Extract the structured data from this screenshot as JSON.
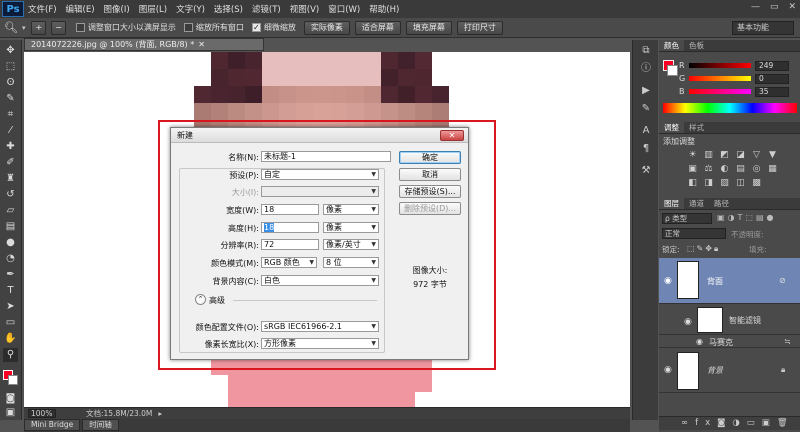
{
  "menubar": {
    "logo": "Ps",
    "items": [
      "文件(F)",
      "编辑(E)",
      "图像(I)",
      "图层(L)",
      "文字(Y)",
      "选择(S)",
      "滤镜(T)",
      "视图(V)",
      "窗口(W)",
      "帮助(H)"
    ],
    "window_controls": [
      "—",
      "▭",
      "✕"
    ]
  },
  "options": {
    "zoom_in_icon": "+",
    "zoom_out_icon": "−",
    "resize_windows_label": "调整窗口大小以满屏显示",
    "zoom_all_label": "缩放所有窗口",
    "scrubby_label": "细微缩放",
    "actual_pixels": "实际像素",
    "fit_screen": "适合屏幕",
    "fill_screen": "填充屏幕",
    "print_size": "打印尺寸",
    "workspace": "基本功能"
  },
  "document": {
    "tab_title": "20140722​26.jpg @ 100% (背面, RGB/8) *",
    "zoom": "100%",
    "doc_size": "文档:15.8M/23.0M",
    "bottom_tabs": [
      "Mini Bridge",
      "时间轴"
    ]
  },
  "panels": {
    "color_tabs": [
      "颜色",
      "色板"
    ],
    "color_values": [
      "249",
      "0",
      "35"
    ],
    "slider_labels": [
      "R",
      "G",
      "B"
    ],
    "adjust_tabs": [
      "调整",
      "样式"
    ],
    "adjust_title": "添加调整",
    "layer_tabs": [
      "图层",
      "通道",
      "路径"
    ],
    "kind_filter": "ρ 类型",
    "blend_mode": "正常",
    "opacity_label": "不透明度:",
    "lock_label": "锁定:",
    "fill_label": "填充:",
    "layers": [
      {
        "name": "背面"
      },
      {
        "name": "智能滤镜"
      },
      {
        "name": "马赛克"
      },
      {
        "name": "背景"
      }
    ]
  },
  "dialog": {
    "title": "新建",
    "name_label": "名称(N):",
    "name_value": "未标题-1",
    "preset_label": "预设(P):",
    "preset_value": "自定",
    "size_label": "大小(I):",
    "width_label": "宽度(W):",
    "width_value": "18",
    "width_unit": "像素",
    "height_label": "高度(H):",
    "height_value": "18",
    "height_unit": "像素",
    "res_label": "分辨率(R):",
    "res_value": "72",
    "res_unit": "像素/英寸",
    "mode_label": "颜色模式(M):",
    "mode_value": "RGB 颜色",
    "bit_value": "8 位",
    "bg_label": "背景内容(C):",
    "bg_value": "白色",
    "advanced_label": "高级",
    "profile_label": "颜色配置文件(O):",
    "profile_value": "sRGB IEC61966-2.1",
    "aspect_label": "像素长宽比(X):",
    "aspect_value": "方形像素",
    "ok": "确定",
    "cancel": "取消",
    "save_preset": "存储预设(S)...",
    "delete_preset": "删除预设(D)...",
    "image_size_label": "图像大小:",
    "image_size_value": "972 字节"
  },
  "colors": {
    "highlight": "#d8171e",
    "foreground": "#f90023"
  }
}
